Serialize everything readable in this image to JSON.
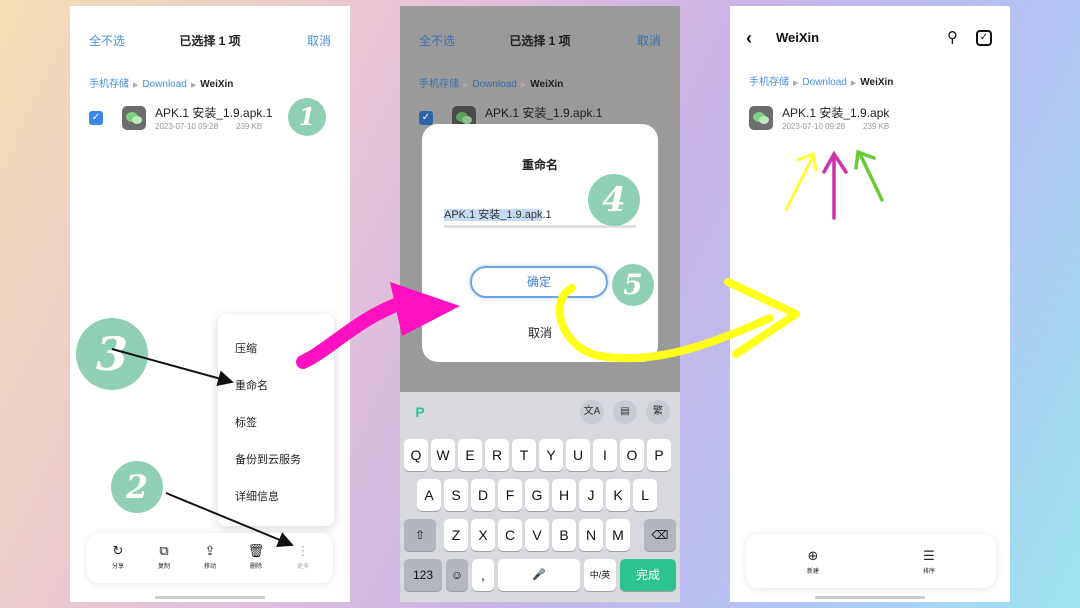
{
  "colors": {
    "accent_blue": "#4a8fe0",
    "badge_green": "#8fd0b4",
    "arrow_magenta": "#ff10c0",
    "arrow_yellow": "#ffff1a",
    "confirm_green": "#2ec48f"
  },
  "panel1": {
    "header": {
      "left": "全不选",
      "title": "已选择 1 项",
      "right": "取消"
    },
    "breadcrumb": {
      "root": "手机存储",
      "mid": "Download",
      "current": "WeiXin"
    },
    "file": {
      "name": "APK.1 安装_1.9.apk.1",
      "date": "2023-07-10 09:28",
      "size": "239 KB",
      "checkbox": "✓"
    },
    "badges": {
      "one": "1",
      "two": "2",
      "three": "3"
    },
    "menu": [
      "压缩",
      "重命名",
      "标签",
      "备份到云服务",
      "详细信息"
    ],
    "toolbar": [
      {
        "icon": "share-icon",
        "glyph": "↻",
        "label": "分享"
      },
      {
        "icon": "copy-icon",
        "glyph": "⧉",
        "label": "复制"
      },
      {
        "icon": "move-icon",
        "glyph": "⇪",
        "label": "移动"
      },
      {
        "icon": "delete-icon",
        "glyph": "🗑",
        "label": "删除"
      },
      {
        "icon": "more-icon",
        "glyph": "⋮",
        "label": "更多"
      }
    ]
  },
  "panel2": {
    "header": {
      "left": "全不选",
      "title": "已选择 1 项",
      "right": "取消"
    },
    "breadcrumb": {
      "root": "手机存储",
      "mid": "Download",
      "current": "WeiXin"
    },
    "file": {
      "name": "APK.1 安装_1.9.apk.1",
      "checkbox": "✓"
    },
    "dialog": {
      "title": "重命名",
      "input_selected": "APK.1 安装_1.9.apk",
      "input_rest": ".1",
      "ok": "确定",
      "cancel": "取消"
    },
    "badges": {
      "four": "4",
      "five": "5"
    },
    "keyboard": {
      "tools": [
        "P",
        "文A",
        "▤",
        "繁"
      ],
      "row1": [
        "Q",
        "W",
        "E",
        "R",
        "T",
        "Y",
        "U",
        "I",
        "O",
        "P"
      ],
      "row2": [
        "A",
        "S",
        "D",
        "F",
        "G",
        "H",
        "J",
        "K",
        "L"
      ],
      "row3": [
        "Z",
        "X",
        "C",
        "V",
        "B",
        "N",
        "M"
      ],
      "shift": "⇧",
      "backspace": "⌫",
      "num": "123",
      "emoji": "☺",
      "comma": ",",
      "mic": "🎤",
      "lang": "中/英",
      "done": "完成"
    }
  },
  "panel3": {
    "header": {
      "back": "‹",
      "title": "WeiXin",
      "search": "⚲",
      "check": "✓"
    },
    "breadcrumb": {
      "root": "手机存储",
      "mid": "Download",
      "current": "WeiXin"
    },
    "file": {
      "name": "APK.1 安装_1.9.apk",
      "date": "2023-07-10 09:28",
      "size": "239 KB"
    },
    "toolbar": [
      {
        "icon": "new-folder-icon",
        "glyph": "⊕",
        "label": "新建"
      },
      {
        "icon": "sort-icon",
        "glyph": "☰",
        "label": "排序"
      }
    ]
  }
}
